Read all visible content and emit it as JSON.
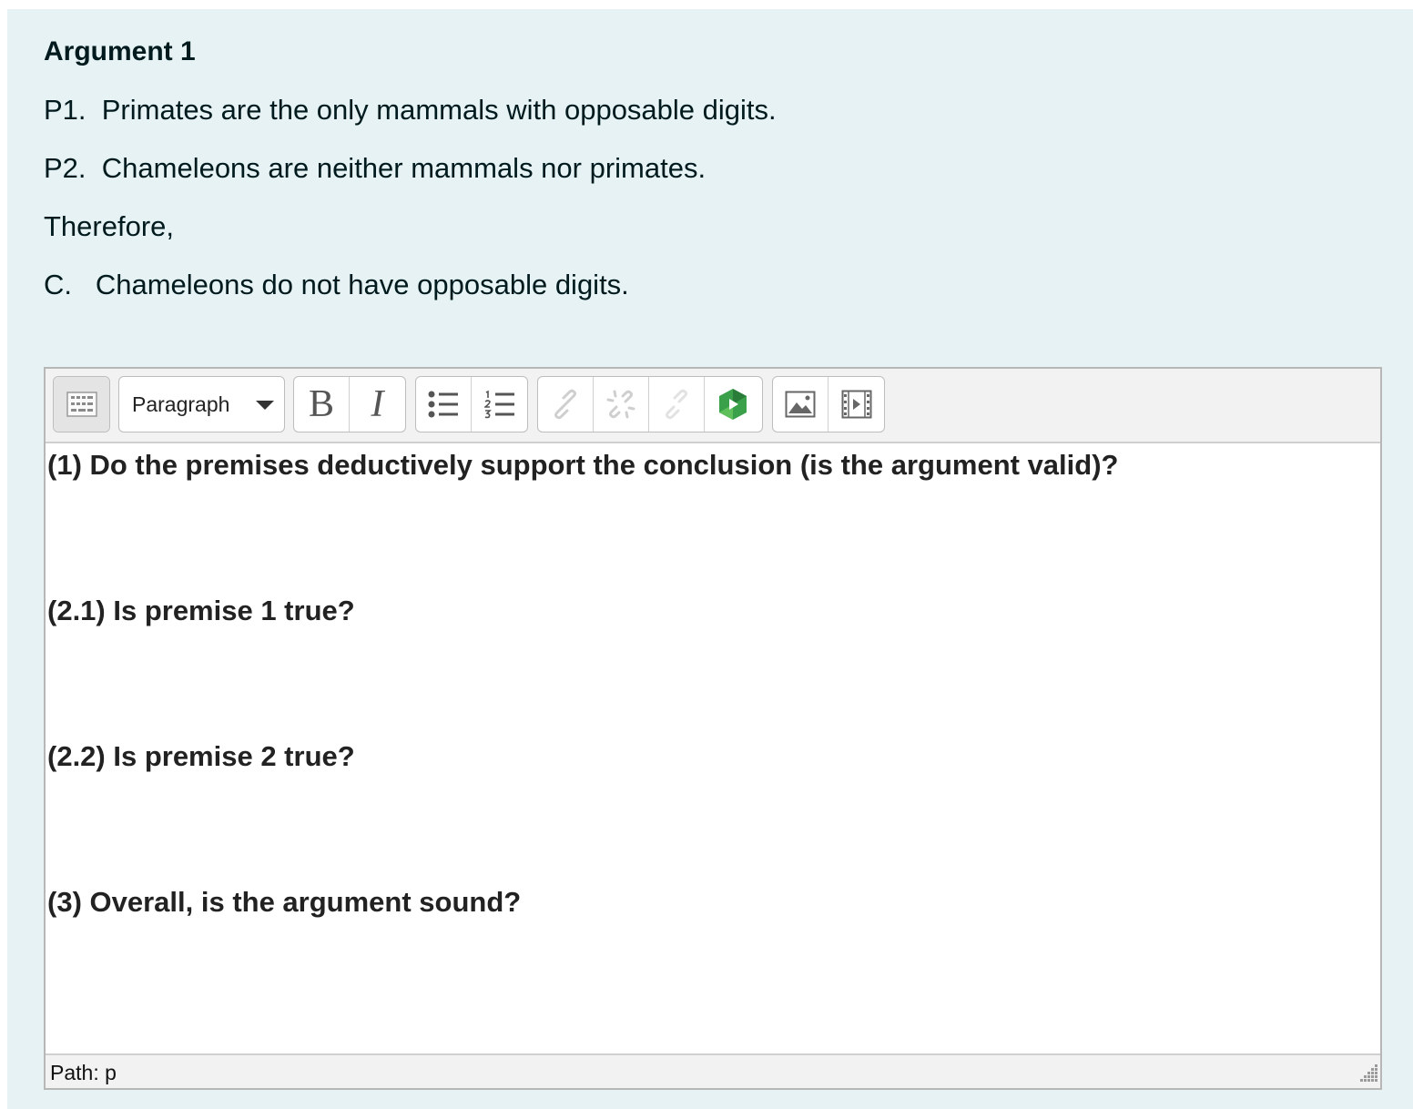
{
  "argument": {
    "title": "Argument 1",
    "lines": [
      "P1.  Primates are the only mammals with opposable digits.",
      "P2.  Chameleons are neither mammals nor primates.",
      "Therefore,",
      "C.   Chameleons do not have opposable digits."
    ]
  },
  "editor": {
    "toolbar": {
      "format_select": "Paragraph",
      "buttons": [
        {
          "icon": "show-more-icon",
          "state": "pressed"
        },
        {
          "icon": "bold-icon",
          "label": "B"
        },
        {
          "icon": "italic-icon",
          "label": "I"
        },
        {
          "icon": "unordered-list-icon"
        },
        {
          "icon": "ordered-list-icon"
        },
        {
          "icon": "link-icon",
          "state": "disabled"
        },
        {
          "icon": "unlink-icon",
          "state": "disabled"
        },
        {
          "icon": "link-disabled-icon",
          "state": "disabled"
        },
        {
          "icon": "panopto-icon"
        },
        {
          "icon": "image-icon"
        },
        {
          "icon": "media-icon"
        }
      ]
    },
    "questions": [
      "(1) Do the premises deductively support the conclusion (is the argument valid)?",
      "(2.1) Is premise 1 true?",
      "(2.2) Is premise 2 true?",
      "(3) Overall, is the argument sound?"
    ],
    "path": "Path: p"
  },
  "colors": {
    "panel_bg": "#e6f2f3",
    "text": "#001a1e",
    "accent_green": "#2e8b3a"
  }
}
